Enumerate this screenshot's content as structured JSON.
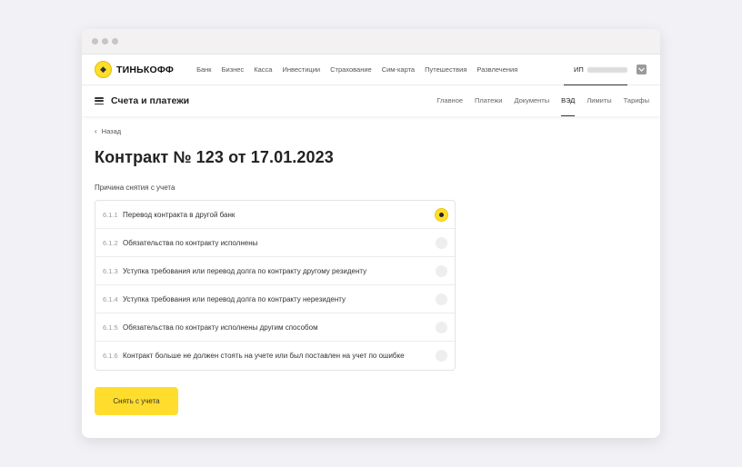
{
  "brand": {
    "name": "ТИНЬКОФФ",
    "accent": "#ffdd2d"
  },
  "top_menu": [
    "Банк",
    "Бизнес",
    "Касса",
    "Инвестиции",
    "Страхование",
    "Сим-карта",
    "Путешествия",
    "Развлечения"
  ],
  "account": {
    "prefix": "ИП"
  },
  "section": {
    "title": "Счета и платежи",
    "tabs": [
      {
        "label": "Главное",
        "active": false
      },
      {
        "label": "Платежи",
        "active": false
      },
      {
        "label": "Документы",
        "active": false
      },
      {
        "label": "ВЭД",
        "active": true
      },
      {
        "label": "Лимиты",
        "active": false
      },
      {
        "label": "Тарифы",
        "active": false
      }
    ]
  },
  "page": {
    "back_label": "Назад",
    "title": "Контракт № 123 от 17.01.2023",
    "reason_label": "Причина снятия с учета",
    "options": [
      {
        "code": "6.1.1",
        "text": "Перевод контракта в другой банк",
        "selected": true
      },
      {
        "code": "6.1.2",
        "text": "Обязательства по контракту исполнены",
        "selected": false
      },
      {
        "code": "6.1.3",
        "text": "Уступка требования или перевод долга по контракту другому резиденту",
        "selected": false
      },
      {
        "code": "6.1.4",
        "text": "Уступка требования или перевод долга по контракту нерезиденту",
        "selected": false
      },
      {
        "code": "6.1.5",
        "text": "Обязательства по контракту исполнены другим способом",
        "selected": false
      },
      {
        "code": "6.1.6",
        "text": "Контракт больше не должен стоять на учете или был поставлен на учет по ошибке",
        "selected": false
      }
    ],
    "submit_label": "Снять с учета"
  }
}
